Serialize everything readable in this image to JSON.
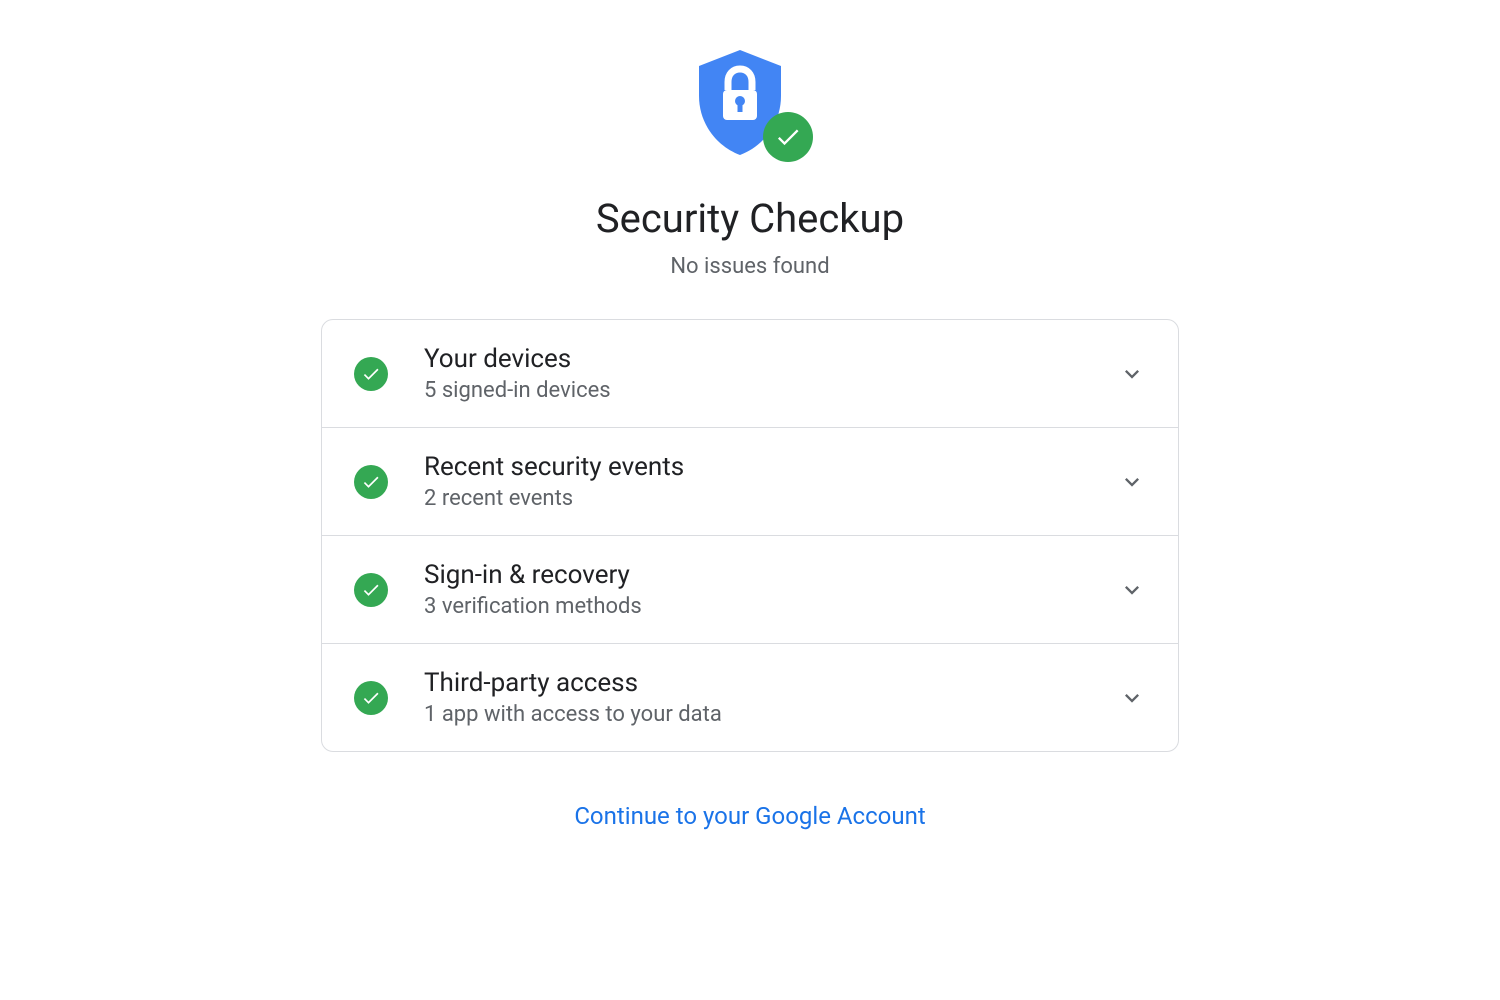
{
  "header": {
    "title": "Security Checkup",
    "subtitle": "No issues found"
  },
  "items": [
    {
      "title": "Your devices",
      "subtitle": "5 signed-in devices",
      "status": "ok"
    },
    {
      "title": "Recent security events",
      "subtitle": "2 recent events",
      "status": "ok"
    },
    {
      "title": "Sign-in & recovery",
      "subtitle": "3 verification methods",
      "status": "ok"
    },
    {
      "title": "Third-party access",
      "subtitle": "1 app with access to your data",
      "status": "ok"
    }
  ],
  "footer": {
    "continue_label": "Continue to your Google Account"
  },
  "colors": {
    "blue": "#4285f4",
    "green": "#34a853",
    "text_primary": "#202124",
    "text_secondary": "#5f6368",
    "link": "#1a73e8",
    "border": "#dadce0"
  }
}
